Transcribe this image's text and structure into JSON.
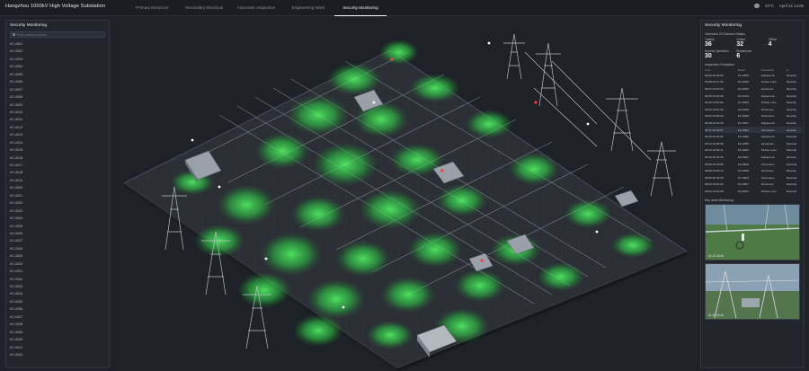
{
  "header": {
    "title": "Hangzhou 1000kV High Voltage Substation",
    "tabs": [
      {
        "label": "Primary Electrical"
      },
      {
        "label": "Secondary Electrical"
      },
      {
        "label": "Automatic Inspection"
      },
      {
        "label": "Engineering Work"
      },
      {
        "label": "Security Monitoring"
      }
    ],
    "temperature": "24°C",
    "datetime": "April 12 14:09"
  },
  "left": {
    "title": "Security Monitoring",
    "search_placeholder": "Enter camera number",
    "cameras": [
      "KC-0001",
      "KC-0002",
      "KC-0003",
      "KC-0004",
      "KC-0005",
      "KC-0006",
      "KC-0007",
      "KC-0008",
      "KC-0009",
      "KC-0010",
      "KC-0011",
      "KC-0012",
      "KC-0013",
      "KC-0014",
      "KC-0015",
      "KC-0016",
      "KC-0017",
      "KC-0018",
      "KC-0019",
      "KC-0020",
      "KC-0021",
      "KC-0022",
      "KC-0023",
      "KC-0024",
      "KC-0025",
      "KC-0026",
      "KC-0027",
      "KC-0028",
      "KC-0029",
      "KC-0030",
      "KC-0031",
      "KC-0032",
      "KC-0033",
      "KC-0034",
      "KC-0035",
      "KC-0036",
      "KC-0037",
      "KC-0038",
      "KC-0039",
      "KC-0040",
      "KC-0041",
      "KC-0042"
    ]
  },
  "right": {
    "title": "Security Monitoring",
    "overview_title": "Overview Of Camera Status",
    "stats": {
      "totality_label": "Totality",
      "totality": "36",
      "online_label": "Online",
      "online": "32",
      "offline_label": "Offline",
      "offline": "4",
      "normal_label": "Normal Operation",
      "normal": "30",
      "breakdown_label": "Breakdown",
      "breakdown": "6"
    },
    "exception_title": "Inspection Exception",
    "columns": [
      "Time",
      "Model",
      "Description",
      "Lv"
    ],
    "rows": [
      [
        "06:30:16:06:05",
        "KC-0009",
        "Equipment...",
        "Severity"
      ],
      [
        "06:28:13:17:33",
        "KC-0025",
        "Picture Loss",
        "Severity"
      ],
      [
        "06:27:13:15:23",
        "KC-0025",
        "abnormal...",
        "Severity"
      ],
      [
        "06:25:13:23:30",
        "KC-0013",
        "Equipment...",
        "Severity"
      ],
      [
        "06:24:13:51:06",
        "KC-0022",
        "Picture Loss",
        "Severity"
      ],
      [
        "06:23:13:51:44",
        "KC-0029",
        "abnormal...",
        "Severity"
      ],
      [
        "06:22:13:05:34",
        "KC-0006",
        "Personnel...",
        "Severity"
      ],
      [
        "06:18:14:34:49",
        "KC-0007",
        "Equipment...",
        "Severity"
      ],
      [
        "06:17:22:44:07",
        "KC-0004",
        "Personnel...",
        "Severity"
      ],
      [
        "06:15:22:26:22",
        "KC-0009",
        "Equipment...",
        "Nominal"
      ],
      [
        "06:14:19:05:36",
        "KC-0050",
        "abnormal...",
        "Nominal"
      ],
      [
        "06:12:13:52:11",
        "KC-0002",
        "Picture Loss",
        "Nominal"
      ],
      [
        "06:10:22:22:20",
        "KC-0001",
        "Equipment...",
        "Severity"
      ],
      [
        "06:09:13:18:09",
        "KC-0003",
        "Personnel...",
        "Nominal"
      ],
      [
        "06:08:13:18:14",
        "KC-0006",
        "abnormal...",
        "Severity"
      ],
      [
        "06:05:20:35:20",
        "KC-0003",
        "Personnel...",
        "Nominal"
      ],
      [
        "06:03:13:20:42",
        "KC-0007",
        "abnormal...",
        "Nominal"
      ],
      [
        "06:02:13:18:35",
        "KC-0021",
        "Picture Loss",
        "Nominal"
      ]
    ],
    "highlight_row": 8,
    "key_area_title": "Key area Monitoring",
    "thumbs": [
      {
        "time": "01-22 16:44"
      },
      {
        "time": "01-22 16:44"
      }
    ]
  },
  "colors": {
    "background": "#1e2127",
    "panel": "#22262c",
    "coverage": "#3fff5a",
    "accent_text": "#e6e8ec"
  }
}
